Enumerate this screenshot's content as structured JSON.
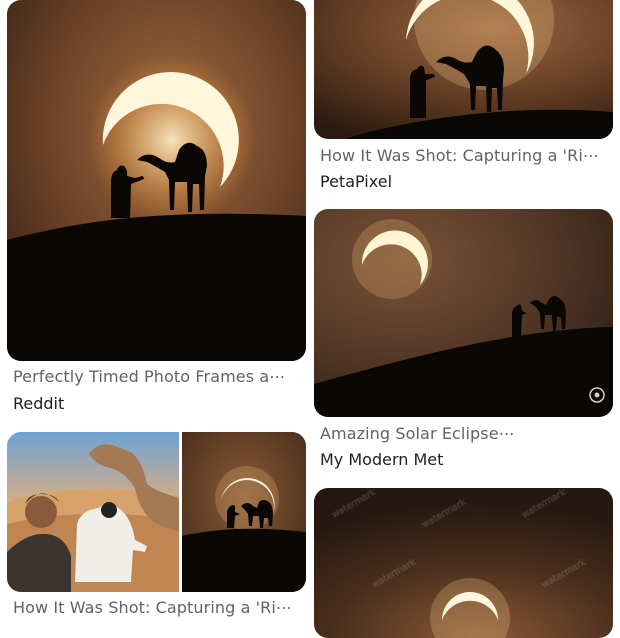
{
  "results": [
    {
      "title": "Perfectly Timed Photo Frames a⋯",
      "source": "Reddit"
    },
    {
      "title": "How It Was Shot: Capturing a 'Ri⋯",
      "source": "PetaPixel"
    },
    {
      "title": "Amazing Solar Eclipse⋯",
      "source": "My Modern Met"
    },
    {
      "title": "How It Was Shot: Capturing a 'Ri⋯",
      "source": ""
    }
  ],
  "colors": {
    "sky_warm": "#8a5a36",
    "sky_dark": "#3a2416",
    "eclipse_glow": "#ffd58a",
    "silhouette": "#0a0705"
  }
}
